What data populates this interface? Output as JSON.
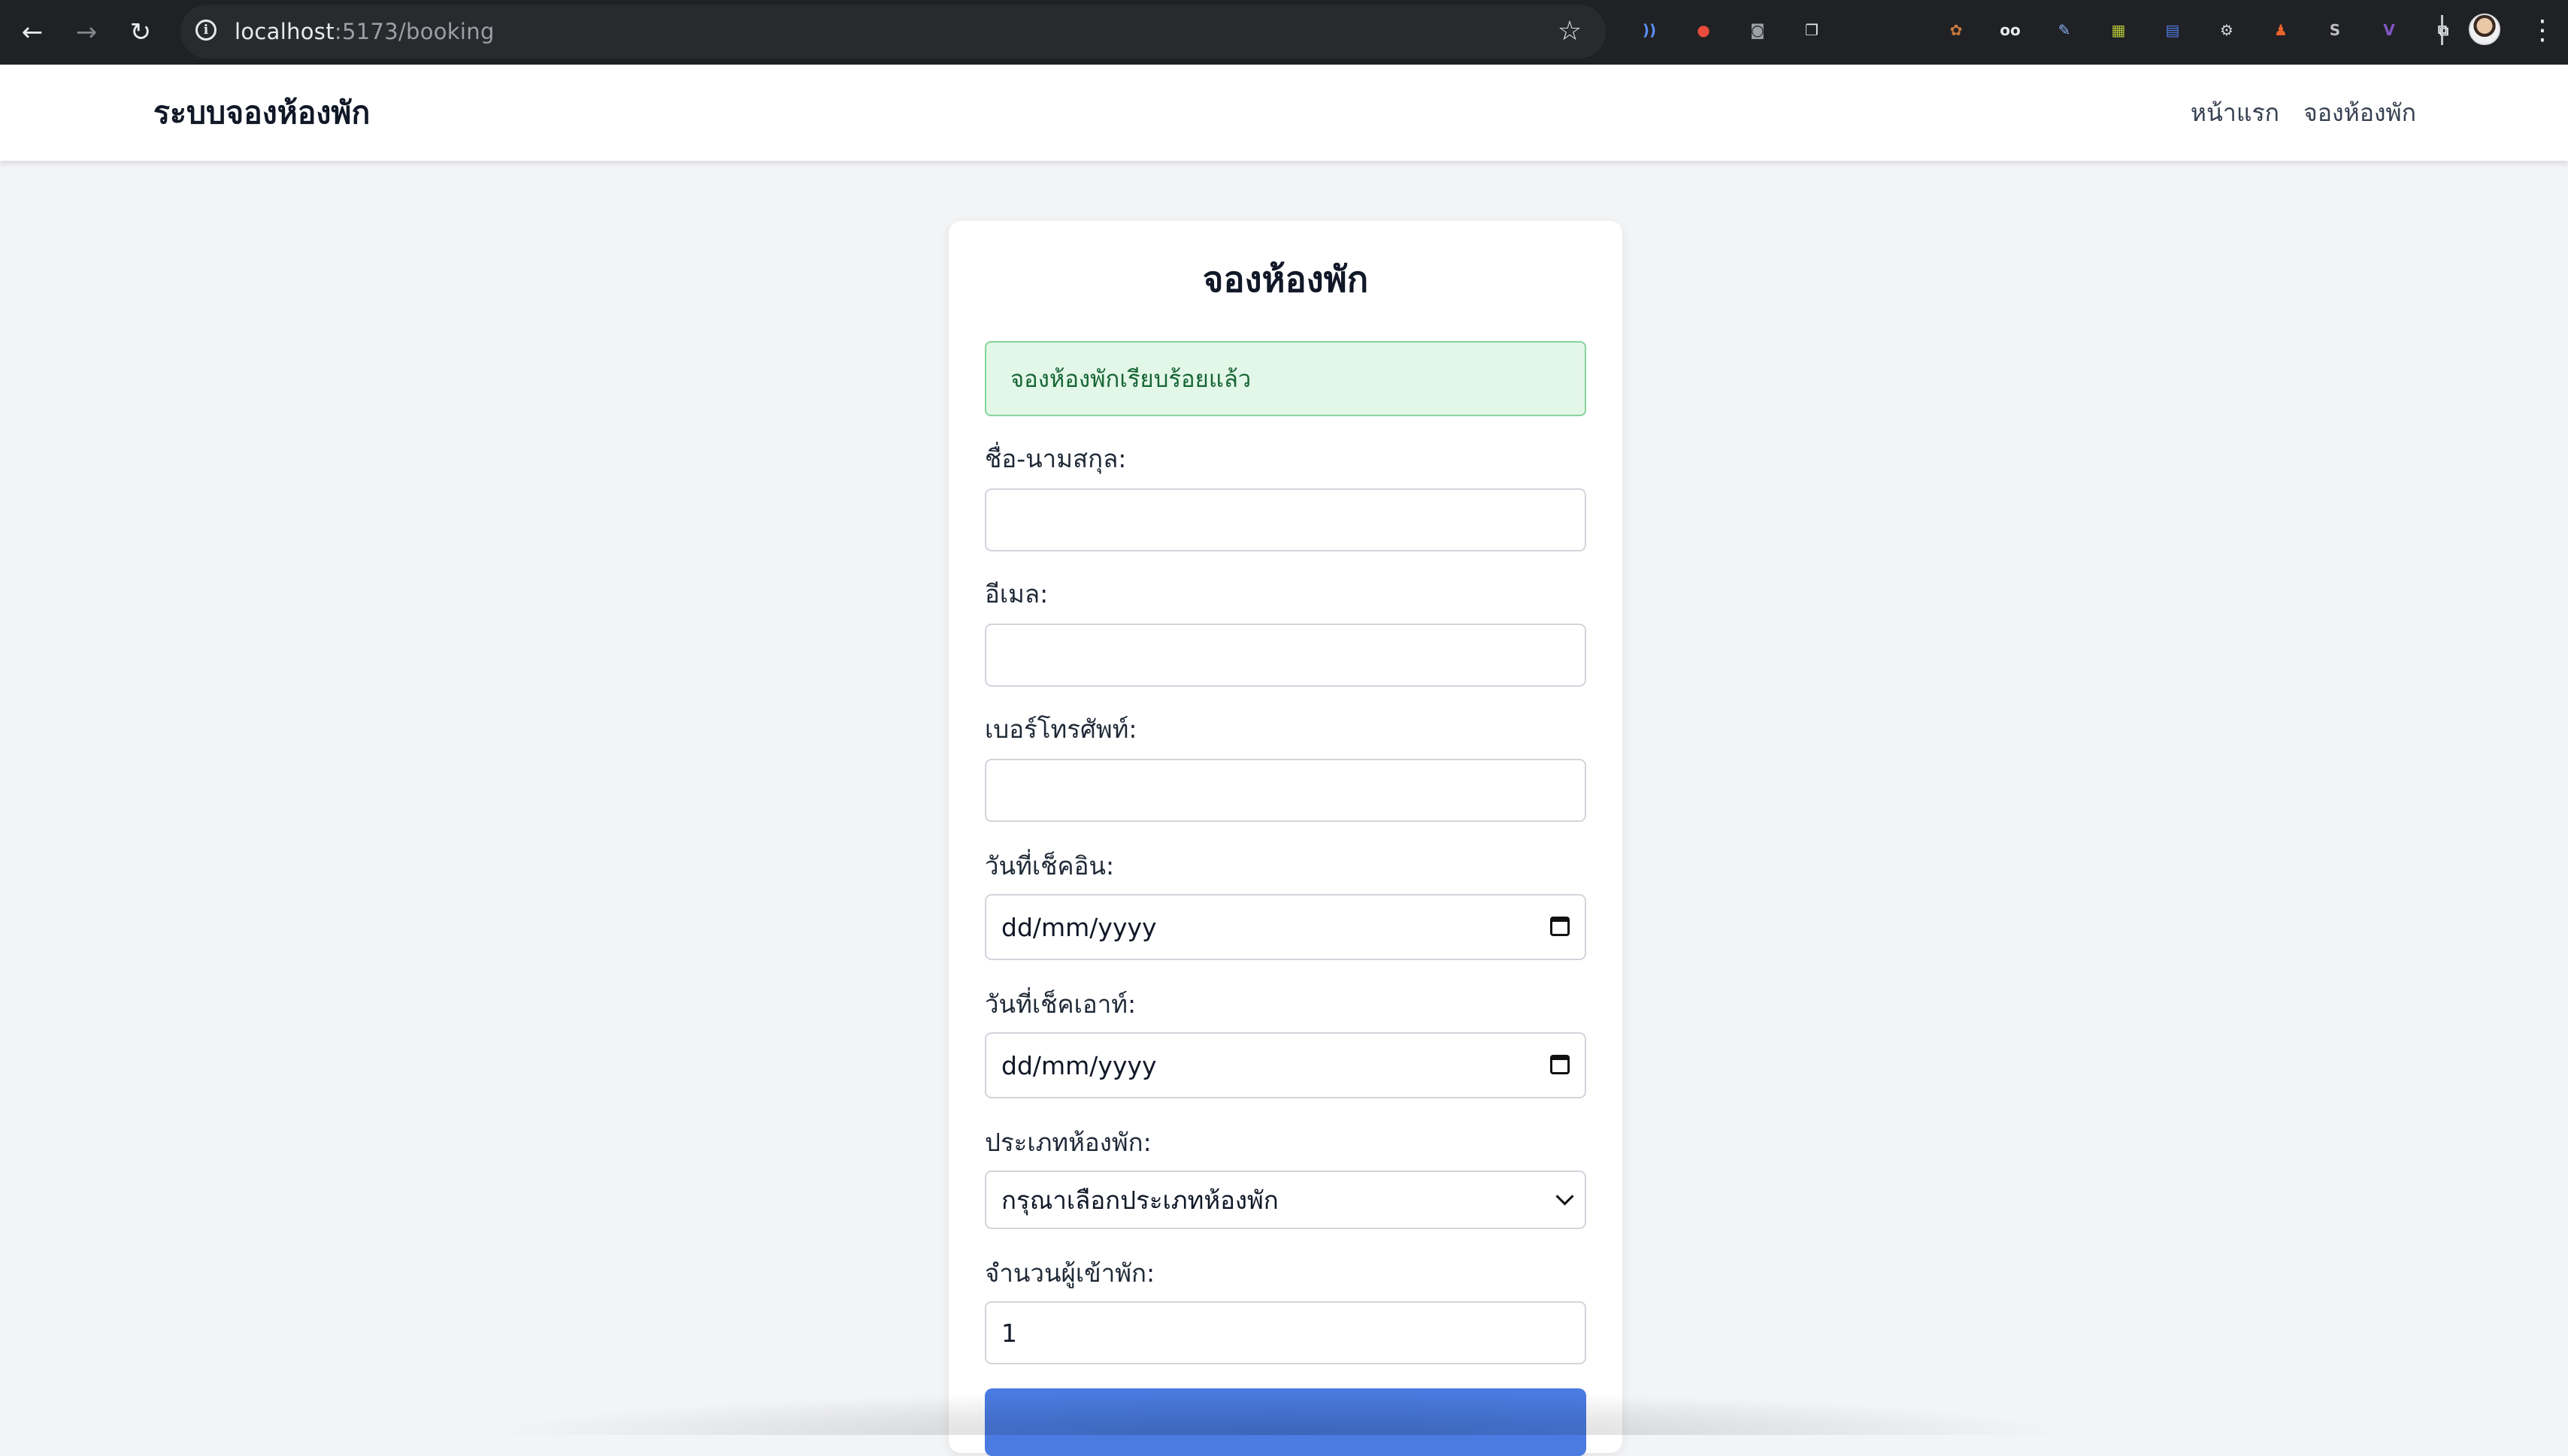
{
  "browser": {
    "url_host": "localhost",
    "url_path": ":5173/booking",
    "extensions": [
      {
        "icon": "wave-extension-icon",
        "color": "#5b8def",
        "glyph": "))"
      },
      {
        "icon": "color-wheel-extension-icon",
        "color": "#e84c3d",
        "glyph": "●"
      },
      {
        "icon": "camera-extension-icon",
        "color": "#9aa0a6",
        "glyph": "◙"
      },
      {
        "icon": "window-star-extension-icon",
        "color": "#e8eaed",
        "glyph": "❐"
      },
      {
        "icon": "cookie-extension-icon",
        "color": "#c77b3c",
        "glyph": "✿"
      },
      {
        "icon": "glasses-extension-icon",
        "color": "#e8eaed",
        "glyph": "oo"
      },
      {
        "icon": "pen-extension-icon",
        "color": "#8ab4f8",
        "glyph": "✎"
      },
      {
        "icon": "image-extension-icon",
        "color": "#b5c63a",
        "glyph": "▦"
      },
      {
        "icon": "doc-extension-icon",
        "color": "#4f7de8",
        "glyph": "▤"
      },
      {
        "icon": "gear-box-extension-icon",
        "color": "#cfd8dc",
        "glyph": "⚙"
      },
      {
        "icon": "figure-extension-icon",
        "color": "#e8632b",
        "glyph": "♟"
      },
      {
        "icon": "swift-extension-icon",
        "color": "#bdbdbd",
        "glyph": "S"
      },
      {
        "icon": "v-extension-icon",
        "color": "#7e57c2",
        "glyph": "V"
      },
      {
        "icon": "puzzle-extension-icon",
        "color": "#e8eaed",
        "glyph": "⧉"
      }
    ]
  },
  "navbar": {
    "brand": "ระบบจองห้องพัก",
    "links": [
      "หน้าแรก",
      "จองห้องพัก"
    ]
  },
  "form": {
    "title": "จองห้องพัก",
    "success_message": "จองห้องพักเรียบร้อยแล้ว",
    "fields": {
      "name_label": "ชื่อ-นามสกุล:",
      "email_label": "อีเมล:",
      "phone_label": "เบอร์โทรศัพท์:",
      "checkin_label": "วันที่เช็คอิน:",
      "checkin_placeholder": "dd/mm/yyyy",
      "checkout_label": "วันที่เช็คเอาท์:",
      "checkout_placeholder": "dd/mm/yyyy",
      "room_type_label": "ประเภทห้องพัก:",
      "room_type_selected": "กรุณาเลือกประเภทห้องพัก",
      "guests_label": "จำนวนผู้เข้าพัก:",
      "guests_value": "1"
    }
  }
}
